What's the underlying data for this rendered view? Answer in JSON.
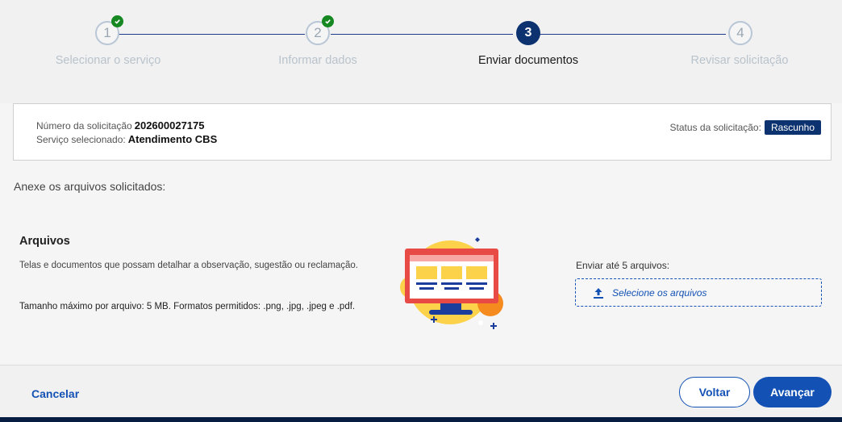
{
  "stepper": {
    "steps": [
      {
        "number": "1",
        "label": "Selecionar o serviço",
        "state": "done"
      },
      {
        "number": "2",
        "label": "Informar dados",
        "state": "done"
      },
      {
        "number": "3",
        "label": "Enviar documentos",
        "state": "active"
      },
      {
        "number": "4",
        "label": "Revisar solicitação",
        "state": "todo"
      }
    ]
  },
  "request": {
    "number_label": "Número da solicitação",
    "number_value": "202600027175",
    "service_label": "Serviço selecionado:",
    "service_value": "Atendimento CBS",
    "status_label": "Status da solicitação:",
    "status_value": "Rascunho"
  },
  "instructions": "Anexe os arquivos solicitados:",
  "files": {
    "title": "Arquivos",
    "description": "Telas e documentos que possam detalhar a observação, sugestão ou reclamação.",
    "limits": "Tamanho máximo por arquivo: 5 MB. Formatos permitidos: .png, .jpg, .jpeg e .pdf.",
    "send_label": "Enviar até 5 arquivos:",
    "select_label": "Selecione os arquivos"
  },
  "footer": {
    "cancel": "Cancelar",
    "back": "Voltar",
    "next": "Avançar"
  },
  "colors": {
    "primary": "#1351b4",
    "dark_blue": "#0c326f",
    "success": "#168821"
  }
}
